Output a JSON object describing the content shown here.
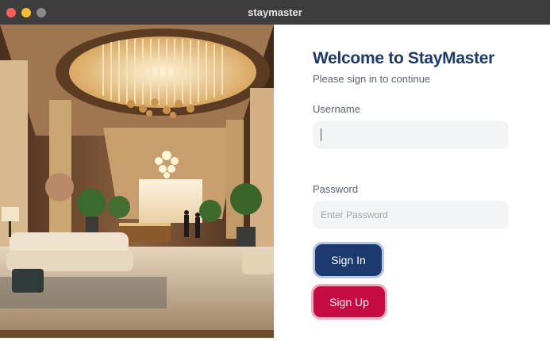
{
  "window": {
    "title": "staymaster"
  },
  "hero": {
    "image": "hotel-lobby-illustration"
  },
  "login": {
    "heading": "Welcome to StayMaster",
    "subtitle": "Please sign in to continue",
    "username_label": "Username",
    "username_value": "",
    "password_label": "Password",
    "password_placeholder": "Enter Password",
    "sign_in_label": "Sign In",
    "sign_up_label": "Sign Up"
  },
  "colors": {
    "titlebar": "#3d3d3d",
    "heading": "#1c3a6e",
    "sign_in_button": "#1c3a6e",
    "sign_up_button": "#c80a42",
    "field_background": "#f3f4f6"
  }
}
